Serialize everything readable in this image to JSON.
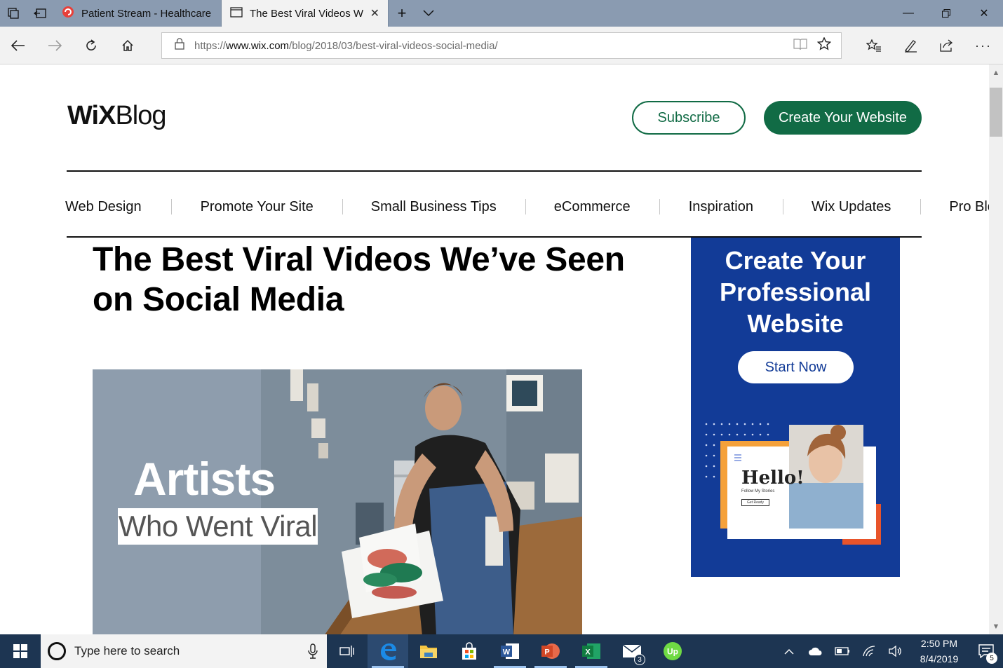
{
  "browser": {
    "tabs": [
      {
        "title": "Patient Stream - Healthcare",
        "active": false
      },
      {
        "title": "The Best Viral Videos W",
        "active": true
      }
    ],
    "url": {
      "scheme": "https://",
      "host": "www.wix.com",
      "path": "/blog/2018/03/best-viral-videos-social-media/"
    },
    "colors": {
      "tabbar": "#8a9bb1",
      "toolbar": "#f2f2f2"
    }
  },
  "page": {
    "logo": {
      "wix": "WiX",
      "blog": "Blog"
    },
    "header_buttons": {
      "subscribe": "Subscribe",
      "create": "Create Your Website"
    },
    "categories": [
      "Web Design",
      "Promote Your Site",
      "Small Business Tips",
      "eCommerce",
      "Inspiration",
      "Wix Updates",
      "Pro Blogs"
    ],
    "article": {
      "title": "The Best Viral Videos We’ve Seen on Social Media",
      "hero": {
        "title": "Artists",
        "subtitle": "Who Went Viral"
      }
    },
    "ad": {
      "title": "Create Your Professional Website",
      "button": "Start Now",
      "mock": {
        "hello": "Hello!",
        "follow": "Follow My Stories",
        "cta": "Get Ready"
      }
    },
    "colors": {
      "wix_green": "#116b45",
      "ad_blue": "#123b97",
      "ad_orange": "#f5a13a"
    }
  },
  "taskbar": {
    "search_placeholder": "Type here to search",
    "apps": [
      "task-view",
      "edge",
      "file-explorer",
      "store",
      "word",
      "powerpoint",
      "excel",
      "mail",
      "upwork"
    ],
    "mail_badge": "3",
    "time": "2:50 PM",
    "date": "8/4/2019",
    "notifications": "5"
  }
}
